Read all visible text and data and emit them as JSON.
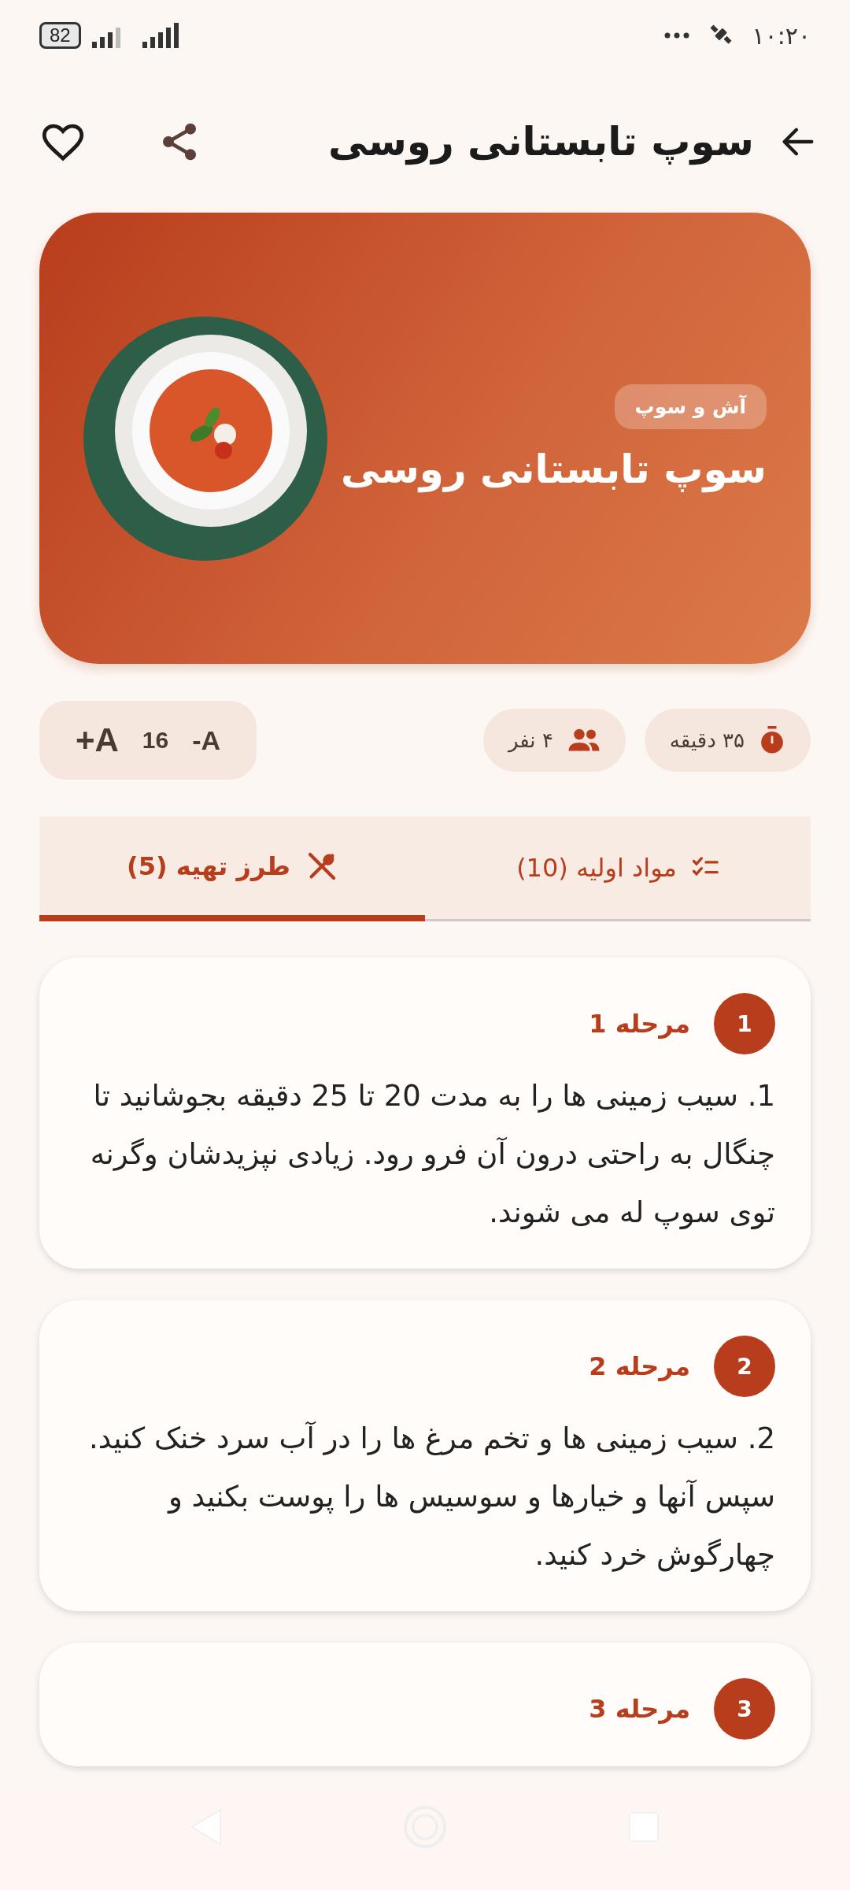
{
  "status_bar": {
    "time": "۱۰:۲۰",
    "battery": "82"
  },
  "header": {
    "title": "سوپ تابستانی روسی"
  },
  "hero": {
    "category": "آش و سوپ",
    "title": "سوپ تابستانی روسی"
  },
  "meta": [
    {
      "kind": "time",
      "text": "۳۵ دقیقه"
    },
    {
      "kind": "servings",
      "text": "۴ نفر"
    }
  ],
  "font_size": {
    "decrease": "-A",
    "value": "16",
    "increase": "+A"
  },
  "tabs": [
    {
      "kind": "ingredients",
      "label": "مواد اولیه (10)",
      "selected": false
    },
    {
      "kind": "method",
      "label": "طرز تهیه (5)",
      "selected": true
    }
  ],
  "steps": [
    {
      "number": "1",
      "title": "مرحله 1",
      "text": "1. سیب زمینی ها را به مدت 20 تا 25 دقیقه بجوشانید تا چنگال به راحتی درون آن فرو رود. زیادی نپزیدشان وگرنه توی سوپ له می شوند."
    },
    {
      "number": "2",
      "title": "مرحله 2",
      "text": "2. سیب زمینی ها و تخم مرغ ها را در آب سرد خنک کنید. سپس آنها و خیارها و سوسیس ها را پوست بکنید و چهارگوش خرد کنید."
    },
    {
      "number": "3",
      "title": "مرحله 3"
    }
  ]
}
